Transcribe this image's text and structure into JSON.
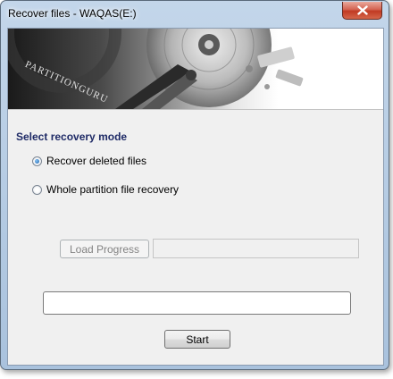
{
  "window": {
    "title": "Recover files - WAQAS(E:)"
  },
  "banner": {
    "brand": "PARTITIONGURU"
  },
  "recovery": {
    "section_title": "Select recovery mode",
    "options": [
      {
        "label": "Recover deleted files",
        "selected": true
      },
      {
        "label": "Whole partition file recovery",
        "selected": false
      }
    ]
  },
  "load_progress": {
    "label": "Load Progress",
    "enabled": false,
    "path_value": ""
  },
  "progress_field_value": "",
  "start": {
    "label": "Start"
  },
  "icons": {
    "close": "close-icon"
  },
  "colors": {
    "section_title": "#1e2a66",
    "close_button": "#c13a23",
    "radio_selected": "#1c5ea8"
  }
}
